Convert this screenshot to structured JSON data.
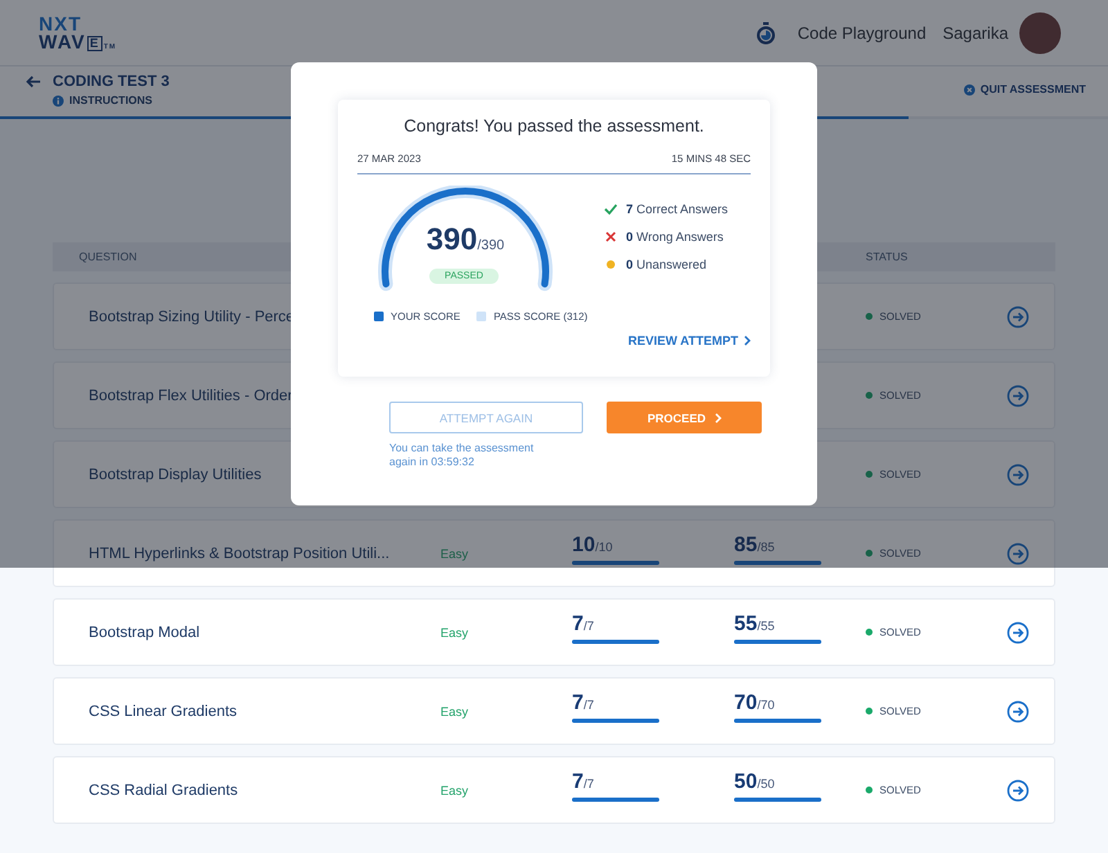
{
  "header": {
    "logo_top": "NXT",
    "logo_bottom": "WAV",
    "logo_box": "E",
    "logo_mark": "TM",
    "link": "Code Playground",
    "user": "Sagarika"
  },
  "subheader": {
    "title": "CODING TEST 3",
    "tab": "INSTRUCTIONS",
    "quit": "QUIT ASSESSMENT",
    "level": 0.82
  },
  "overlay": {
    "on": true
  },
  "table": {
    "columns": [
      {
        "kind": "question",
        "label": "QUESTION"
      },
      {
        "kind": "status",
        "label": "STATUS"
      }
    ],
    "rows": [
      {
        "question": "Bootstrap Sizing Utility - Perce",
        "status": "SOLVED"
      },
      {
        "question": "Bootstrap Flex Utilities - Order",
        "status": "SOLVED"
      },
      {
        "question": "Bootstrap Display Utilities",
        "status": "SOLVED"
      },
      {
        "question": "HTML Hyperlinks & Bootstrap Position Utili...",
        "difficulty": "Easy",
        "score": {
          "value": "10",
          "total": "/10",
          "level": 1
        },
        "marks": {
          "value": "85",
          "total": "/85",
          "level": 1
        },
        "status": "SOLVED"
      },
      {
        "question": "Bootstrap Modal",
        "difficulty": "Easy",
        "score": {
          "value": "7",
          "total": "/7",
          "level": 1
        },
        "marks": {
          "value": "55",
          "total": "/55",
          "level": 1
        },
        "status": "SOLVED"
      },
      {
        "question": "CSS Linear Gradients",
        "difficulty": "Easy",
        "score": {
          "value": "7",
          "total": "/7",
          "level": 1
        },
        "marks": {
          "value": "70",
          "total": "/70",
          "level": 1
        },
        "status": "SOLVED"
      },
      {
        "question": "CSS Radial Gradients",
        "difficulty": "Easy",
        "score": {
          "value": "7",
          "total": "/7",
          "level": 1
        },
        "marks": {
          "value": "50",
          "total": "/50",
          "level": 1
        },
        "status": "SOLVED"
      }
    ]
  },
  "modal": {
    "title": "Congrats! You passed the assessment.",
    "date": "27 MAR 2023",
    "duration": "15 MINS 48 SEC",
    "score": "390",
    "total": "/390",
    "badge": "PASSED",
    "level": 1,
    "stats": [
      {
        "kind": "correct",
        "count": "7",
        "label": "Correct Answers"
      },
      {
        "kind": "wrong",
        "count": "0",
        "label": "Wrong Answers"
      },
      {
        "kind": "unanswered",
        "count": "0",
        "label": "Unanswered"
      }
    ],
    "legend": [
      {
        "kind": "your",
        "label": "YOUR SCORE"
      },
      {
        "kind": "pass",
        "label": "PASS SCORE (312)"
      }
    ],
    "review": "REVIEW ATTEMPT",
    "attempt_again": {
      "label": "ATTEMPT AGAIN",
      "disabled": true
    },
    "proceed": "PROCEED",
    "note": "You can take the assessment again in 03:59:32"
  }
}
